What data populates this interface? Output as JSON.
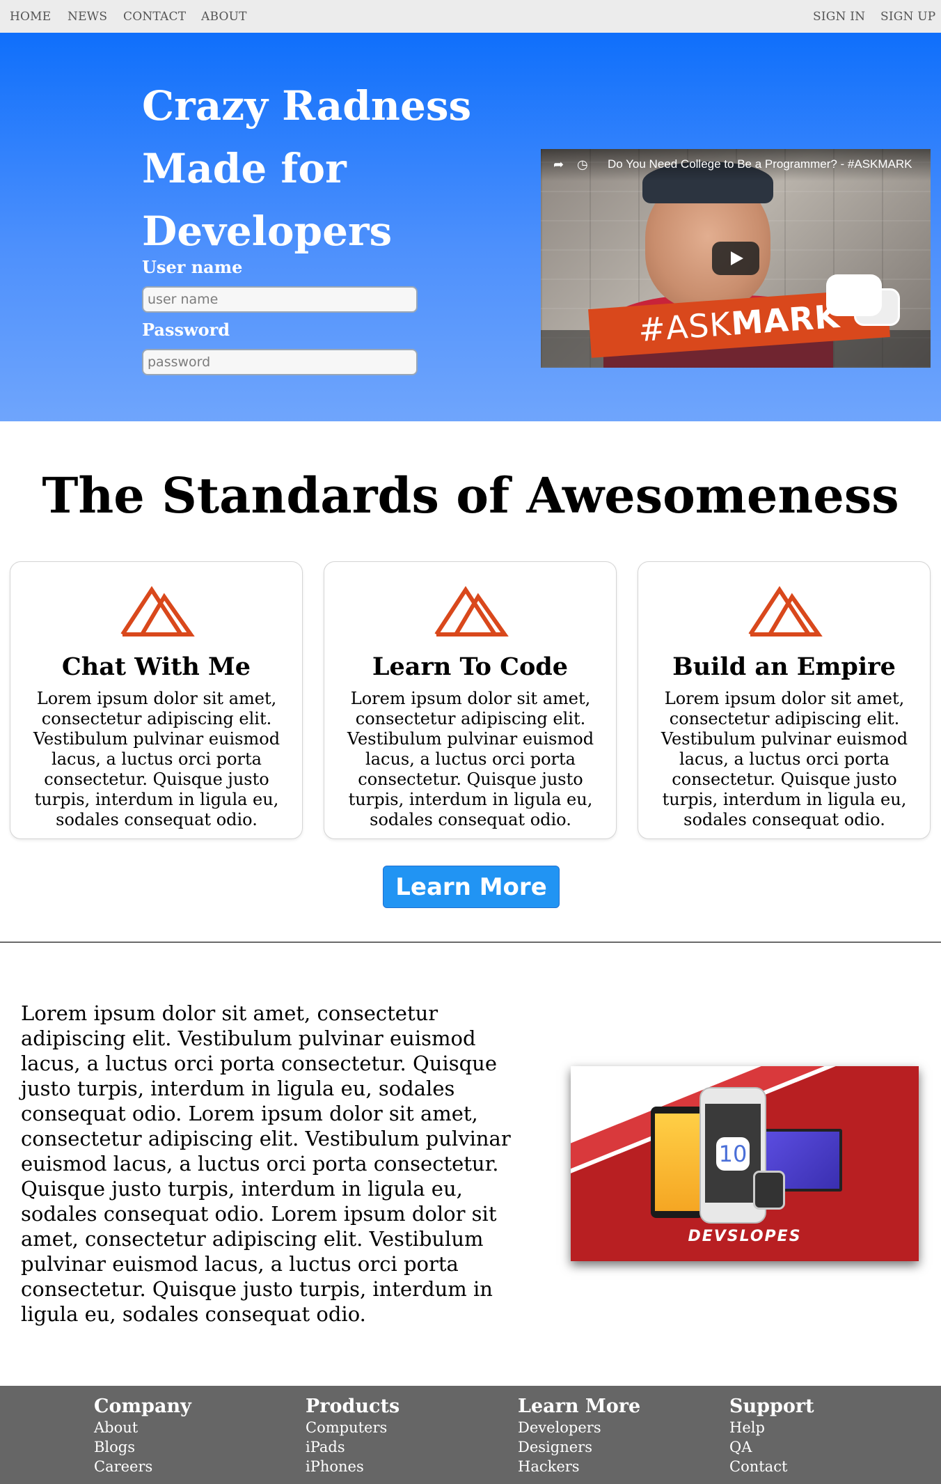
{
  "nav": {
    "left": [
      "HOME",
      "NEWS",
      "CONTACT",
      "ABOUT"
    ],
    "right": [
      "SIGN IN",
      "SIGN UP"
    ]
  },
  "hero": {
    "title": "Crazy Radness Made for Developers",
    "username_label": "User name",
    "username_placeholder": "user name",
    "password_label": "Password",
    "password_placeholder": "password",
    "video": {
      "title": "Do You Need College to Be a Programmer? - #ASKMARK",
      "banner_prefix": "#ASK",
      "banner_bold": "MARK"
    },
    "gradient_top": "#0f6ffb",
    "gradient_bottom": "#6fa5fc"
  },
  "standards": {
    "title": "The Standards of Awesomeness",
    "icon": "mountain-icon",
    "icon_color": "#d9481c",
    "cards": [
      {
        "title": "Chat With Me",
        "text": "Lorem ipsum dolor sit amet, consectetur adipiscing elit. Vestibulum pulvinar euismod lacus, a luctus orci porta consectetur. Quisque justo turpis, interdum in ligula eu, sodales consequat odio."
      },
      {
        "title": "Learn To Code",
        "text": "Lorem ipsum dolor sit amet, consectetur adipiscing elit. Vestibulum pulvinar euismod lacus, a luctus orci porta consectetur. Quisque justo turpis, interdum in ligula eu, sodales consequat odio."
      },
      {
        "title": "Build an Empire",
        "text": "Lorem ipsum dolor sit amet, consectetur adipiscing elit. Vestibulum pulvinar euismod lacus, a luctus orci porta consectetur. Quisque justo turpis, interdum in ligula eu, sodales consequat odio."
      }
    ],
    "button": "Learn More",
    "button_color": "#2194f3"
  },
  "about": {
    "text": "Lorem ipsum dolor sit amet, consectetur adipiscing elit. Vestibulum pulvinar euismod lacus, a luctus orci porta consectetur. Quisque justo turpis, interdum in ligula eu, sodales consequat odio. Lorem ipsum dolor sit amet, consectetur adipiscing elit. Vestibulum pulvinar euismod lacus, a luctus orci porta consectetur. Quisque justo turpis, interdum in ligula eu, sodales consequat odio. Lorem ipsum dolor sit amet, consectetur adipiscing elit. Vestibulum pulvinar euismod lacus, a luctus orci porta consectetur. Quisque justo turpis, interdum in ligula eu, sodales consequat odio.",
    "image": {
      "brand": "DEVSLOPES",
      "os_label": "10",
      "color": "#b81f22"
    }
  },
  "footer": {
    "background": "#666666",
    "columns": [
      {
        "heading": "Company",
        "links": [
          "About",
          "Blogs",
          "Careers"
        ]
      },
      {
        "heading": "Products",
        "links": [
          "Computers",
          "iPads",
          "iPhones"
        ]
      },
      {
        "heading": "Learn More",
        "links": [
          "Developers",
          "Designers",
          "Hackers"
        ]
      },
      {
        "heading": "Support",
        "links": [
          "Help",
          "QA",
          "Contact"
        ]
      }
    ]
  }
}
